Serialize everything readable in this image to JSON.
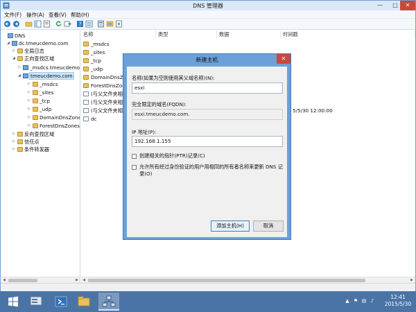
{
  "window": {
    "title": "DNS 管理器",
    "minimize": "—",
    "maximize": "□",
    "close": "✕"
  },
  "menu": [
    "文件(F)",
    "操作(A)",
    "查看(V)",
    "帮助(H)"
  ],
  "toolbar": {
    "icons": [
      "back-icon",
      "forward-icon",
      "up-icon",
      "show-tree-icon",
      "properties-icon",
      "refresh-icon",
      "export-icon",
      "help-icon",
      "details-icon",
      "server-icon",
      "zone-icon",
      "new-record-icon"
    ]
  },
  "tree": {
    "root": "DNS",
    "server": "dc.tmeucdemo.com",
    "global_logs": "全局日志",
    "forward_zones": "正向查找区域",
    "msdcs_zone": "_msdcs.tmeucdemo.com",
    "main_zone": "tmeucdemo.com",
    "children": [
      "_msdcs",
      "_sites",
      "_tcp",
      "_udp",
      "DomainDnsZones",
      "ForestDnsZones"
    ],
    "reverse_zones": "反向查找区域",
    "trust_points": "信任点",
    "conditional_forwarders": "条件转发器"
  },
  "list": {
    "columns": [
      "名称",
      "类型",
      "数据",
      "时间戳"
    ],
    "rows": [
      {
        "name": "_msdcs",
        "type": "folder"
      },
      {
        "name": "_sites",
        "type": "folder"
      },
      {
        "name": "_tcp",
        "type": "folder"
      },
      {
        "name": "_udp",
        "type": "folder"
      },
      {
        "name": "DomainDnsZo",
        "type": "folder"
      },
      {
        "name": "ForestDnsZone",
        "type": "folder"
      },
      {
        "name": "(与父文件夹相同)",
        "type": "doc"
      },
      {
        "name": "(与父文件夹相同)",
        "type": "doc"
      },
      {
        "name": "(与父文件夹相同)",
        "type": "doc"
      },
      {
        "name": "dc",
        "type": "doc"
      }
    ],
    "timestamp_visible": "5/5/30 12:00:00"
  },
  "dialog": {
    "title": "新建主机",
    "close": "✕",
    "name_label": "名称(如果为空则使用其父域名称)(N):",
    "name_value": "esxi",
    "fqdn_label": "完全限定的域名(FQDN):",
    "fqdn_value": "esxi.tmeucdemo.com.",
    "ip_label": "IP 地址(P):",
    "ip_value": "192.168.1.155",
    "ptr_label": "创建相关的指针(PTR)记录(C)",
    "auth_label_line1": "允许所有经过身份验证的用户用相同的所有者名称来更新 DNS 记",
    "auth_label_line2": "录(O)",
    "add_button": "添加主机(H)",
    "cancel_button": "取消"
  },
  "taskbar": {
    "time": "12:41",
    "date": "2015/5/30",
    "tray_icons": [
      "chevron-up-icon",
      "flag-icon",
      "network-icon",
      "speaker-icon",
      "ime-icon"
    ]
  }
}
